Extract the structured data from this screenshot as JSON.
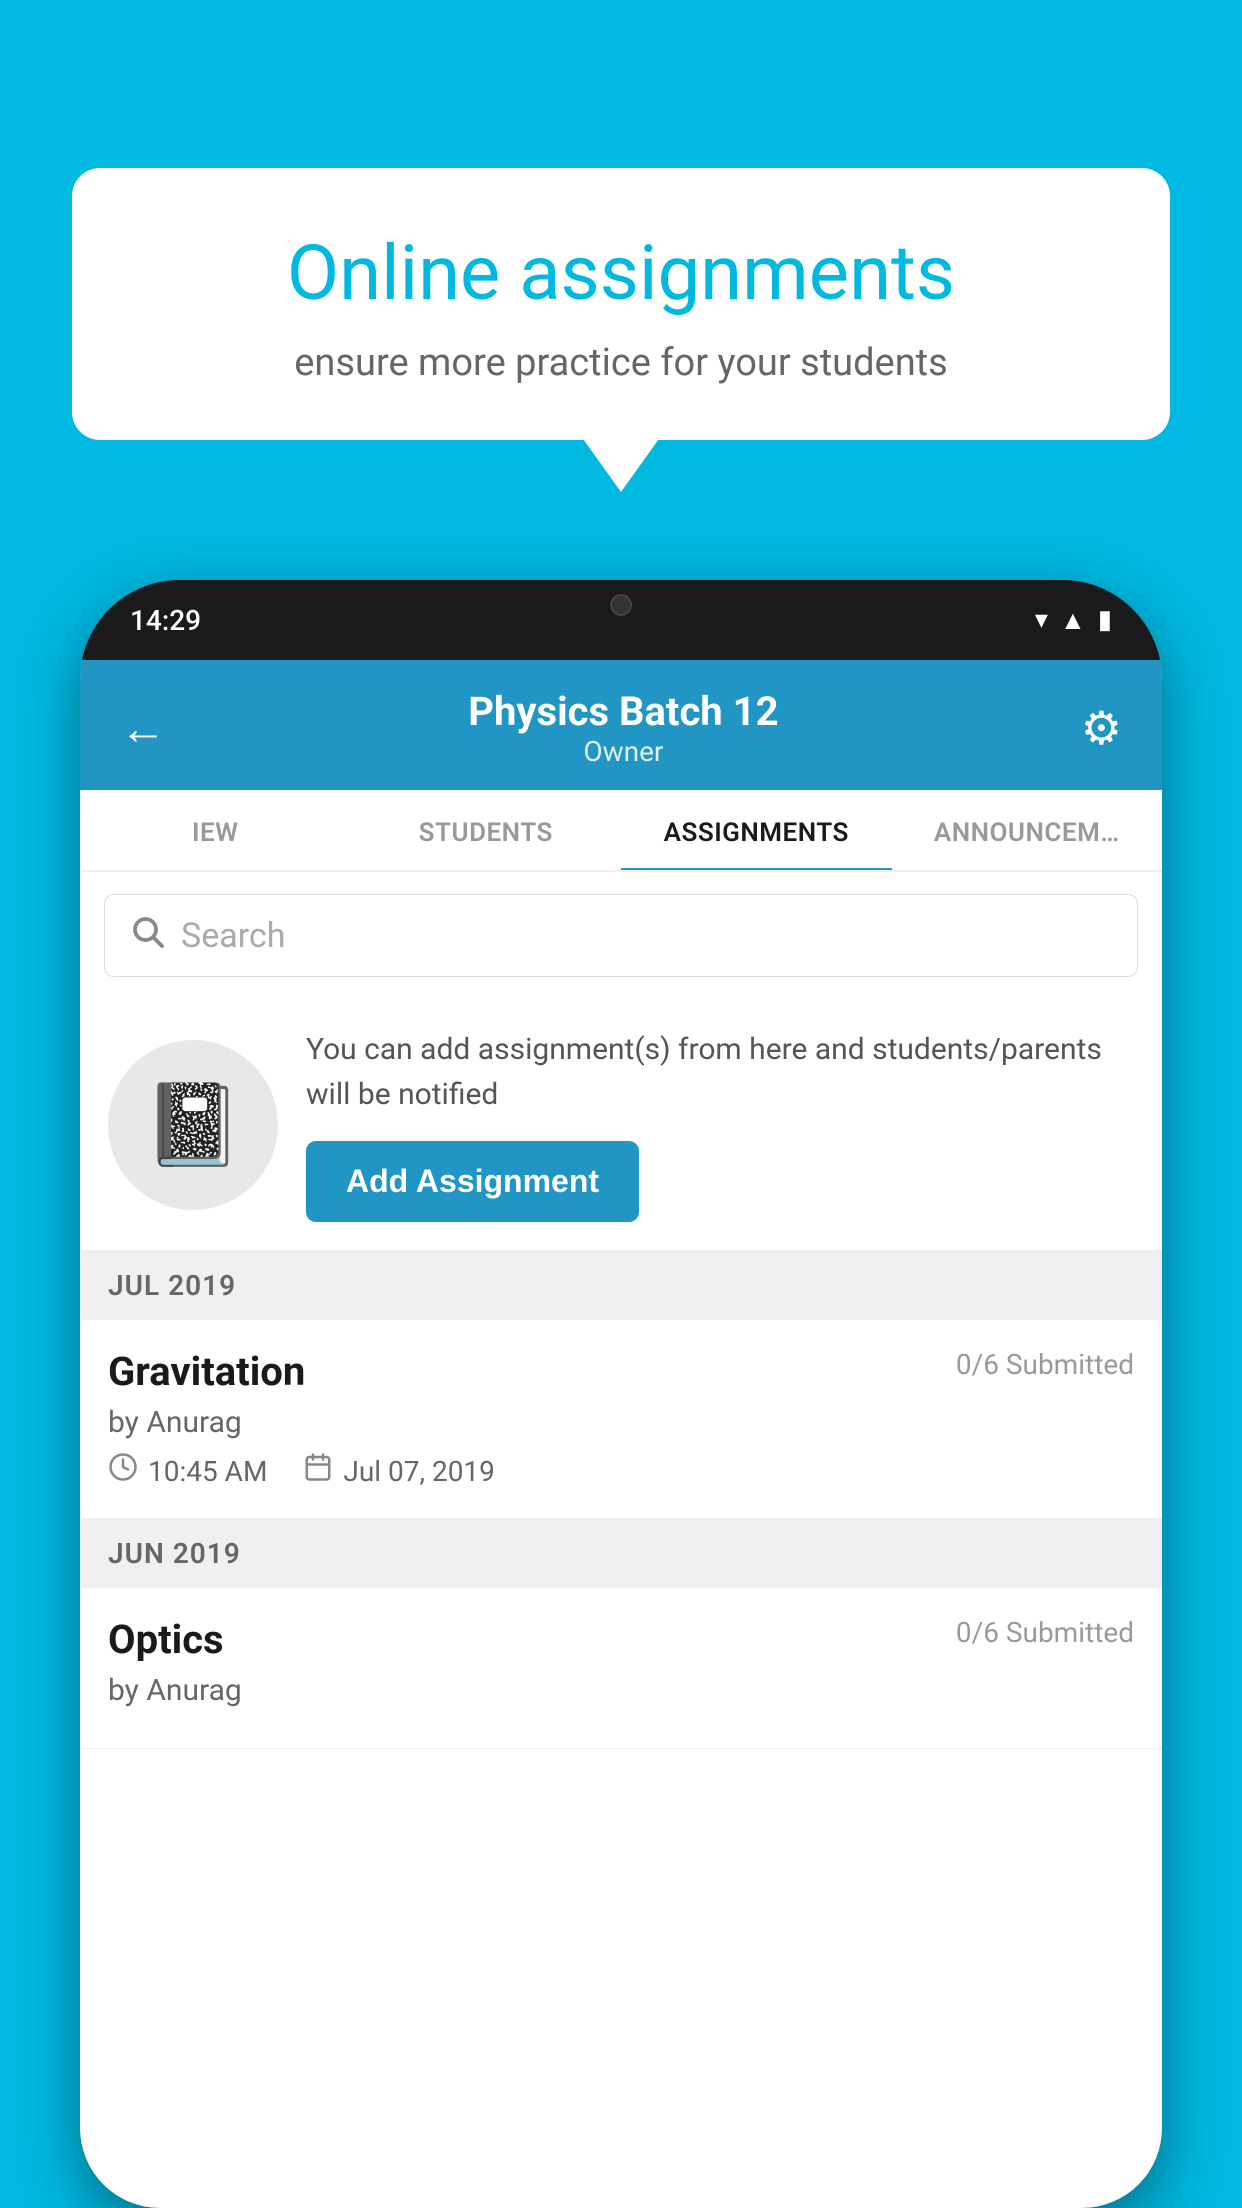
{
  "background_color": "#00b8e0",
  "speech_bubble": {
    "title": "Online assignments",
    "subtitle": "ensure more practice for your students"
  },
  "phone": {
    "status_bar": {
      "time": "14:29",
      "wifi_icon": "▼",
      "signal_icon": "▲",
      "battery_icon": "▮"
    },
    "header": {
      "title": "Physics Batch 12",
      "subtitle": "Owner",
      "back_icon": "←",
      "settings_icon": "⚙"
    },
    "tabs": [
      {
        "label": "IEW",
        "active": false
      },
      {
        "label": "STUDENTS",
        "active": false
      },
      {
        "label": "ASSIGNMENTS",
        "active": true
      },
      {
        "label": "ANNOUNCEM…",
        "active": false
      }
    ],
    "search": {
      "placeholder": "Search"
    },
    "promo": {
      "description": "You can add assignment(s) from here and students/parents will be notified",
      "button_label": "Add Assignment"
    },
    "assignment_sections": [
      {
        "month_label": "JUL 2019",
        "assignments": [
          {
            "name": "Gravitation",
            "submitted": "0/6 Submitted",
            "author": "by Anurag",
            "time": "10:45 AM",
            "date": "Jul 07, 2019"
          }
        ]
      },
      {
        "month_label": "JUN 2019",
        "assignments": [
          {
            "name": "Optics",
            "submitted": "0/6 Submitted",
            "author": "by Anurag",
            "time": "",
            "date": ""
          }
        ]
      }
    ]
  }
}
